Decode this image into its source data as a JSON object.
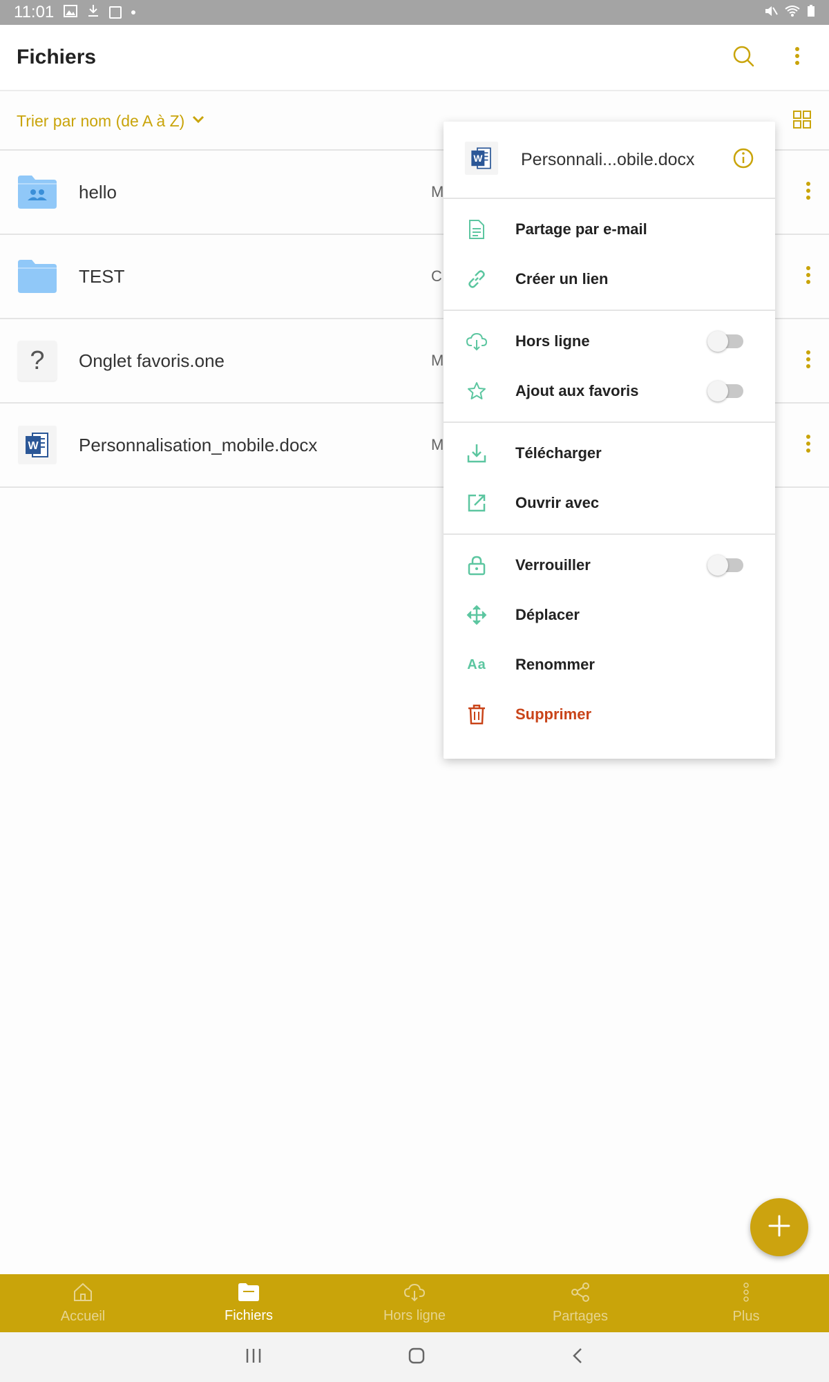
{
  "status_bar": {
    "time": "11:01"
  },
  "app_bar": {
    "title": "Fichiers"
  },
  "sort": {
    "label": "Trier par nom (de A à Z)"
  },
  "files": [
    {
      "name": "hello",
      "meta": "M",
      "icon": "shared-folder-icon"
    },
    {
      "name": "TEST",
      "meta": "Cı",
      "icon": "folder-icon"
    },
    {
      "name": "Onglet favoris.one",
      "meta": "M",
      "icon": "unknown-file-icon",
      "glyph": "?"
    },
    {
      "name": "Personnalisation_mobile.docx",
      "meta": "M",
      "icon": "word-doc-icon"
    }
  ],
  "menu": {
    "file_name": "Personnali...obile.docx",
    "items": [
      {
        "label": "Partage par e-mail",
        "icon": "email-document-icon"
      },
      {
        "label": "Créer un lien",
        "icon": "link-icon"
      },
      {
        "label": "Hors ligne",
        "icon": "cloud-download-icon",
        "toggle": false
      },
      {
        "label": "Ajout aux favoris",
        "icon": "star-icon",
        "toggle": false
      },
      {
        "label": "Télécharger",
        "icon": "download-icon"
      },
      {
        "label": "Ouvrir avec",
        "icon": "open-external-icon"
      },
      {
        "label": "Verrouiller",
        "icon": "lock-icon",
        "toggle": false
      },
      {
        "label": "Déplacer",
        "icon": "move-icon"
      },
      {
        "label": "Renommer",
        "icon": "rename-icon",
        "glyph": "Aa"
      },
      {
        "label": "Supprimer",
        "icon": "trash-icon",
        "danger": true
      }
    ]
  },
  "bottom_nav": [
    {
      "label": "Accueil",
      "icon": "home-icon",
      "active": false
    },
    {
      "label": "Fichiers",
      "icon": "files-folder-icon",
      "active": true
    },
    {
      "label": "Hors ligne",
      "icon": "offline-cloud-icon",
      "active": false
    },
    {
      "label": "Partages",
      "icon": "share-icon",
      "active": false
    },
    {
      "label": "Plus",
      "icon": "more-vertical-icon",
      "active": false
    }
  ],
  "colors": {
    "accent": "#c9a40a",
    "menu_icon": "#5cc6a0",
    "danger": "#c94419",
    "folder": "#90c8f8"
  }
}
